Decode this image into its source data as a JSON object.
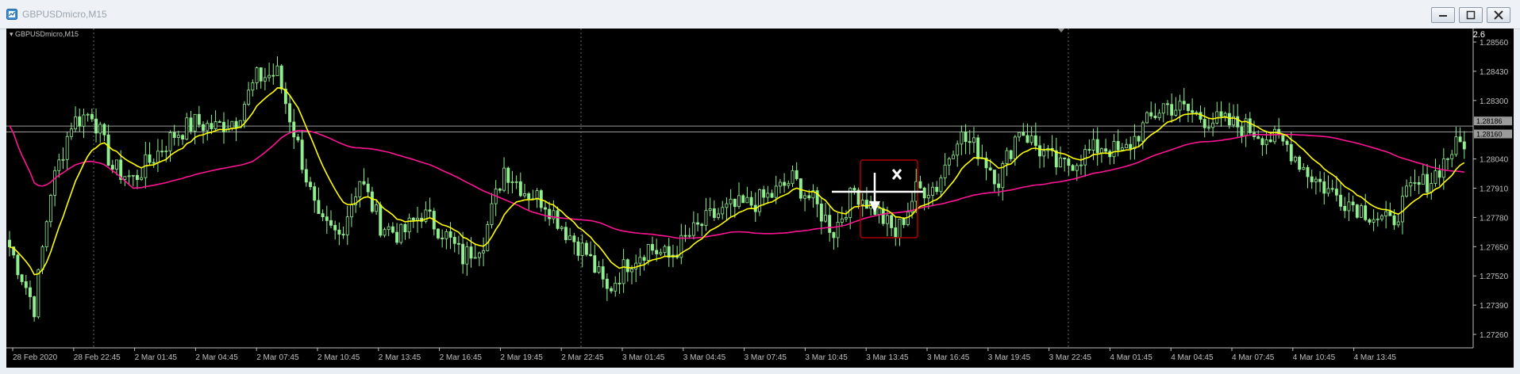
{
  "window": {
    "title": "GBPUSDmicro,M15"
  },
  "chart": {
    "symbol_label": "GBPUSDmicro,M15",
    "spread": "2.6",
    "colors": {
      "background": "#000000",
      "bull_candle": "#90ee90",
      "bear_candle": "#90ee90",
      "ma_fast": "#ffff00",
      "ma_slow": "#ff1493",
      "grid": "#6a6a6a",
      "axis_text": "#c0c0c0",
      "box": "#b00000"
    }
  },
  "chart_data": {
    "type": "candlestick",
    "ylim": [
      1.272,
      1.2862
    ],
    "y_ticks": [
      "1.28560",
      "1.28430",
      "1.28300",
      "1.28040",
      "1.27910",
      "1.27780",
      "1.27650",
      "1.27520",
      "1.27390",
      "1.27260"
    ],
    "x_ticks": [
      "28 Feb 2020",
      "28 Feb 22:45",
      "2 Mar 01:45",
      "2 Mar 04:45",
      "2 Mar 07:45",
      "2 Mar 10:45",
      "2 Mar 13:45",
      "2 Mar 16:45",
      "2 Mar 19:45",
      "2 Mar 22:45",
      "3 Mar 01:45",
      "3 Mar 04:45",
      "3 Mar 07:45",
      "3 Mar 10:45",
      "3 Mar 13:45",
      "3 Mar 16:45",
      "3 Mar 19:45",
      "3 Mar 22:45",
      "4 Mar 01:45",
      "4 Mar 04:45",
      "4 Mar 07:45",
      "4 Mar 10:45",
      "4 Mar 13:45"
    ],
    "price_levels": [
      {
        "value": 1.28186,
        "label": "1.28186"
      },
      {
        "value": 1.2816,
        "label": "1.28160"
      }
    ],
    "close_anchors": [
      [
        0,
        1.2765
      ],
      [
        3,
        1.2752
      ],
      [
        6,
        1.2738
      ],
      [
        10,
        1.279
      ],
      [
        15,
        1.282
      ],
      [
        20,
        1.2825
      ],
      [
        25,
        1.28
      ],
      [
        30,
        1.2795
      ],
      [
        35,
        1.2805
      ],
      [
        40,
        1.2815
      ],
      [
        45,
        1.282
      ],
      [
        50,
        1.2818
      ],
      [
        55,
        1.2822
      ],
      [
        60,
        1.284
      ],
      [
        65,
        1.2842
      ],
      [
        70,
        1.281
      ],
      [
        75,
        1.2775
      ],
      [
        80,
        1.277
      ],
      [
        85,
        1.2795
      ],
      [
        90,
        1.2775
      ],
      [
        95,
        1.277
      ],
      [
        100,
        1.278
      ],
      [
        105,
        1.2772
      ],
      [
        110,
        1.276
      ],
      [
        115,
        1.2768
      ],
      [
        120,
        1.28
      ],
      [
        125,
        1.279
      ],
      [
        130,
        1.2785
      ],
      [
        135,
        1.2772
      ],
      [
        140,
        1.2762
      ],
      [
        145,
        1.2745
      ],
      [
        150,
        1.2758
      ],
      [
        155,
        1.2765
      ],
      [
        160,
        1.276
      ],
      [
        165,
        1.277
      ],
      [
        170,
        1.2778
      ],
      [
        175,
        1.2782
      ],
      [
        180,
        1.2784
      ],
      [
        185,
        1.2788
      ],
      [
        190,
        1.2795
      ],
      [
        195,
        1.2785
      ],
      [
        200,
        1.2772
      ],
      [
        205,
        1.279
      ],
      [
        210,
        1.2782
      ],
      [
        215,
        1.277
      ],
      [
        220,
        1.279
      ],
      [
        225,
        1.2792
      ],
      [
        230,
        1.2815
      ],
      [
        235,
        1.2808
      ],
      [
        240,
        1.2795
      ],
      [
        245,
        1.2818
      ],
      [
        250,
        1.2808
      ],
      [
        255,
        1.28
      ],
      [
        260,
        1.2805
      ],
      [
        265,
        1.281
      ],
      [
        270,
        1.2806
      ],
      [
        275,
        1.2818
      ],
      [
        280,
        1.2828
      ],
      [
        285,
        1.2826
      ],
      [
        290,
        1.2822
      ],
      [
        295,
        1.282
      ],
      [
        300,
        1.2818
      ],
      [
        305,
        1.2814
      ],
      [
        310,
        1.281
      ],
      [
        315,
        1.2798
      ],
      [
        320,
        1.279
      ],
      [
        325,
        1.2785
      ],
      [
        330,
        1.278
      ],
      [
        335,
        1.2775
      ],
      [
        340,
        1.279
      ],
      [
        345,
        1.2795
      ],
      [
        350,
        1.2808
      ],
      [
        353,
        1.2812
      ]
    ],
    "ma_fast_label": "",
    "ma_slow_label": ""
  }
}
